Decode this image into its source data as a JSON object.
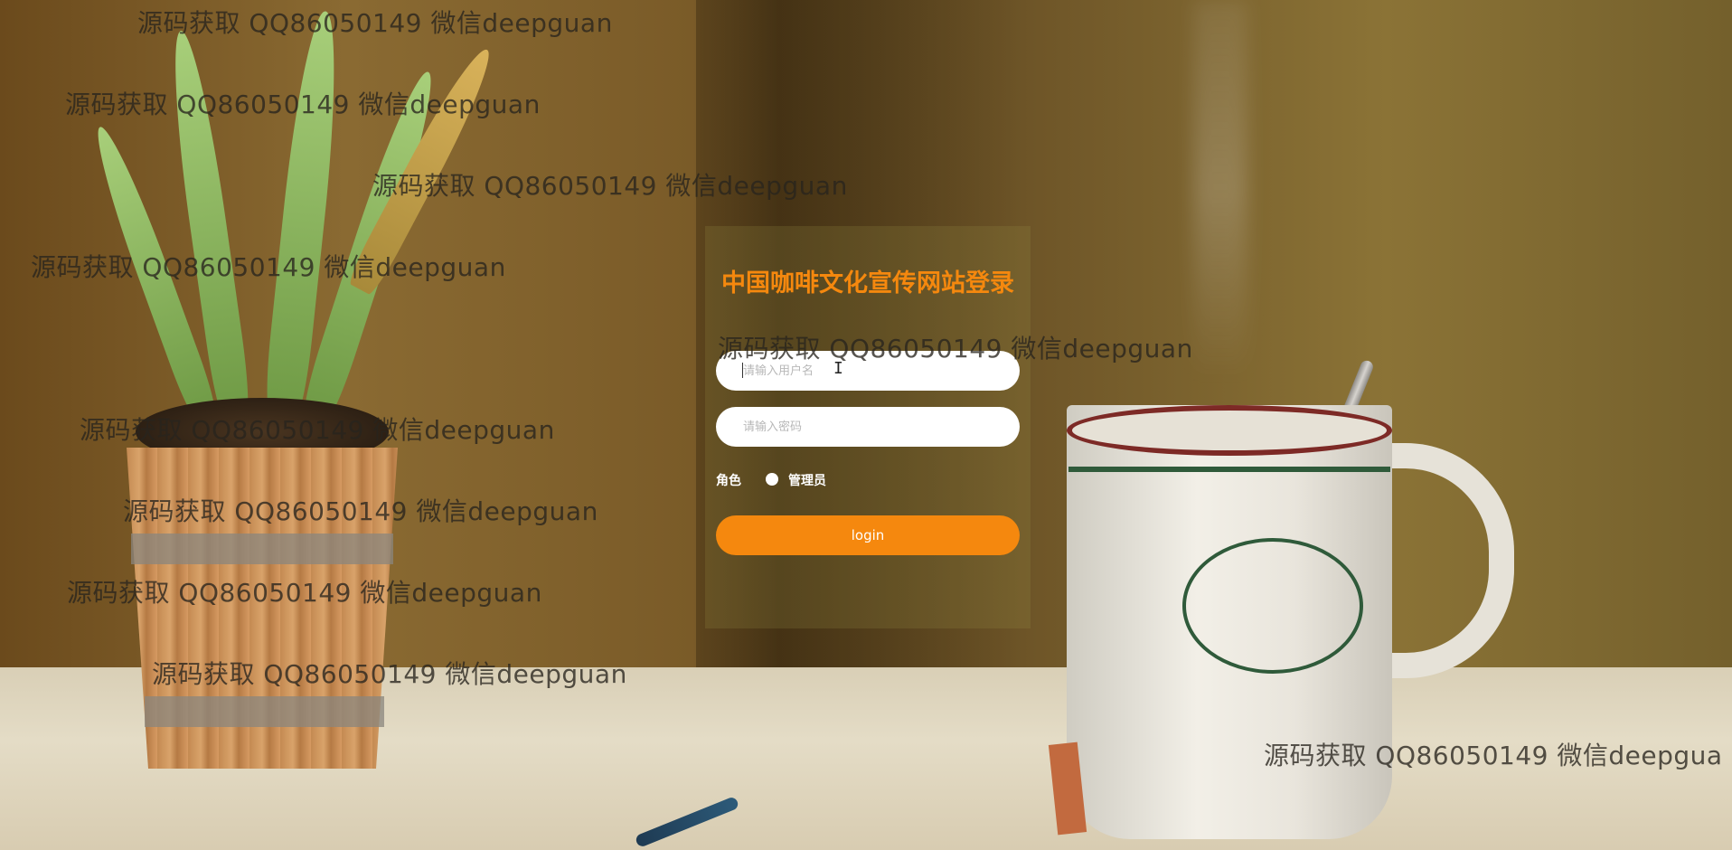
{
  "login": {
    "title": "中国咖啡文化宣传网站登录",
    "username_placeholder": "请输入用户名",
    "password_placeholder": "请输入密码",
    "role_label": "角色",
    "role_option": "管理员",
    "submit_label": "login"
  },
  "watermarks": {
    "text": "源码获取 QQ86050149 微信deepguan",
    "truncated_text": "源码获取 QQ86050149 微信deepgua"
  },
  "colors": {
    "accent": "#f5880e",
    "input_bg": "#ffffff",
    "watermark": "#28241e"
  }
}
